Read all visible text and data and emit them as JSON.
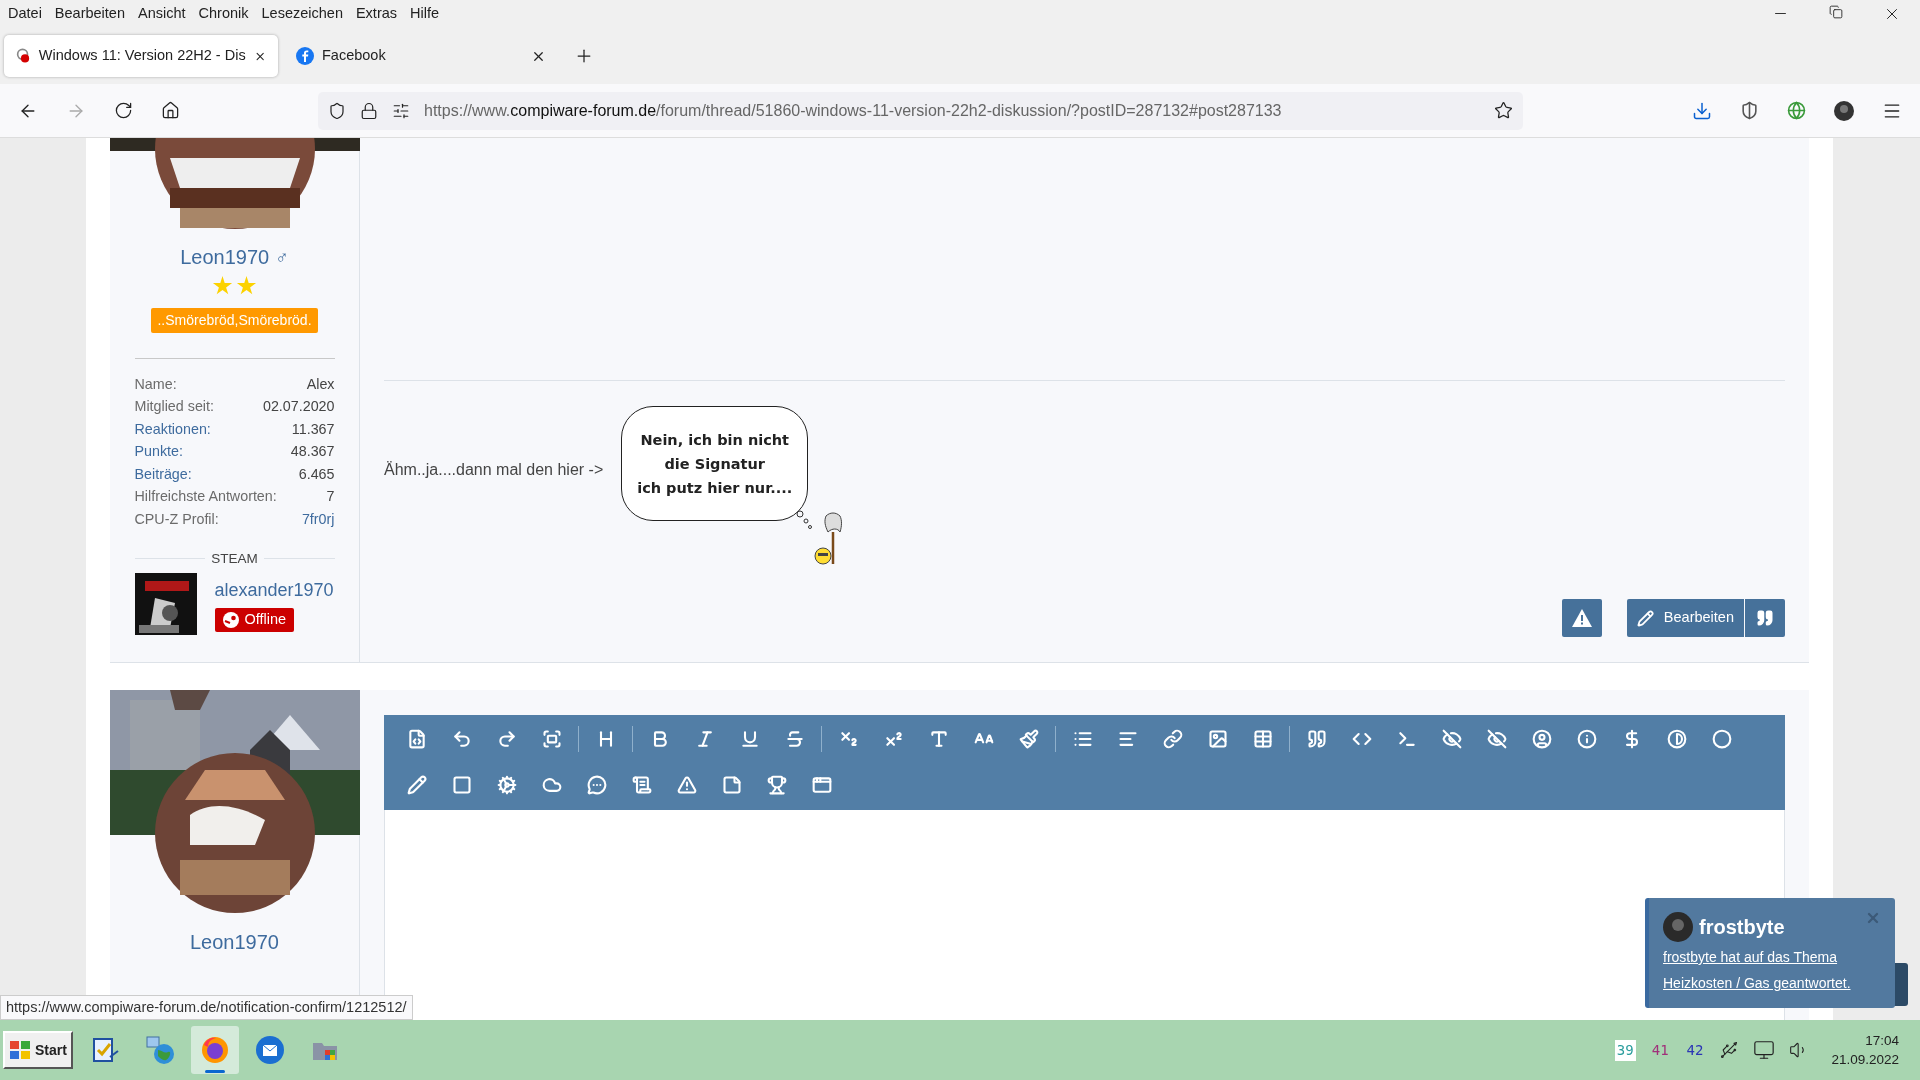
{
  "menu_bar": [
    "Datei",
    "Bearbeiten",
    "Ansicht",
    "Chronik",
    "Lesezeichen",
    "Extras",
    "Hilfe"
  ],
  "tabs": [
    {
      "title": "Windows 11: Version 22H2 - Dis",
      "selected": true,
      "kind": "forum"
    },
    {
      "title": "Facebook",
      "selected": false,
      "kind": "facebook"
    }
  ],
  "url": {
    "scheme": "https://www.",
    "domain": "compiware-forum.de",
    "path": "/forum/thread/51860-windows-11-version-22h2-diskussion/?postID=287132#post287133"
  },
  "post": {
    "author": {
      "name": "Leon1970",
      "gender_symbol": "♂",
      "rank_symbols": [
        {
          "kind": "star"
        },
        {
          "kind": "star"
        }
      ],
      "rank": "..Smörebröd,Smörebröd.",
      "stats": [
        {
          "label": "Name:",
          "value": "Alex",
          "label_link": false,
          "value_link": false
        },
        {
          "label": "Mitglied seit:",
          "value": "02.07.2020",
          "label_link": false,
          "value_link": false
        },
        {
          "label": "Reaktionen:",
          "value": "11.367",
          "label_link": true,
          "value_link": false
        },
        {
          "label": "Punkte:",
          "value": "48.367",
          "label_link": true,
          "value_link": false
        },
        {
          "label": "Beiträge:",
          "value": "6.465",
          "label_link": true,
          "value_link": false
        },
        {
          "label": "Hilfreichste Antworten:",
          "value": "7",
          "label_link": false,
          "value_link": false
        },
        {
          "label": "CPU-Z Profil:",
          "value": "7fr0rj",
          "label_link": false,
          "value_link": true
        }
      ],
      "steam": {
        "heading": "STEAM",
        "username": "alexander1970",
        "status": "Offline",
        "kind": "offline"
      }
    },
    "text": "Ähm..ja....dann mal den hier ->",
    "signature_bubble": [
      "Nein, ich bin nicht",
      "die Signatur",
      "ich putz hier nur...."
    ],
    "edit_button": "Bearbeiten"
  },
  "reply_editor": {
    "author": {
      "name": "Leon1970"
    }
  },
  "status_url": "https://www.compiware-forum.de/notification-confirm/1212512/",
  "notification": {
    "user": "frostbyte",
    "message": "frostbyte hat auf das Thema Heizkosten / Gas geantwortet."
  },
  "taskbar": {
    "start": "Start",
    "apps": [
      {
        "kind": "checklist",
        "selected": false
      },
      {
        "kind": "network",
        "selected": false
      },
      {
        "kind": "firefox",
        "selected": true
      },
      {
        "kind": "mail",
        "selected": false
      },
      {
        "kind": "folder",
        "selected": false
      }
    ]
  },
  "tray": {
    "temperatures": [
      {
        "value": "39",
        "color": "#2a9d9d",
        "boxed": true
      },
      {
        "value": "41",
        "color": "#a0307a",
        "boxed": false
      },
      {
        "value": "42",
        "color": "#2b35b5",
        "boxed": false
      }
    ],
    "time": "17:04",
    "date": "21.09.2022"
  }
}
